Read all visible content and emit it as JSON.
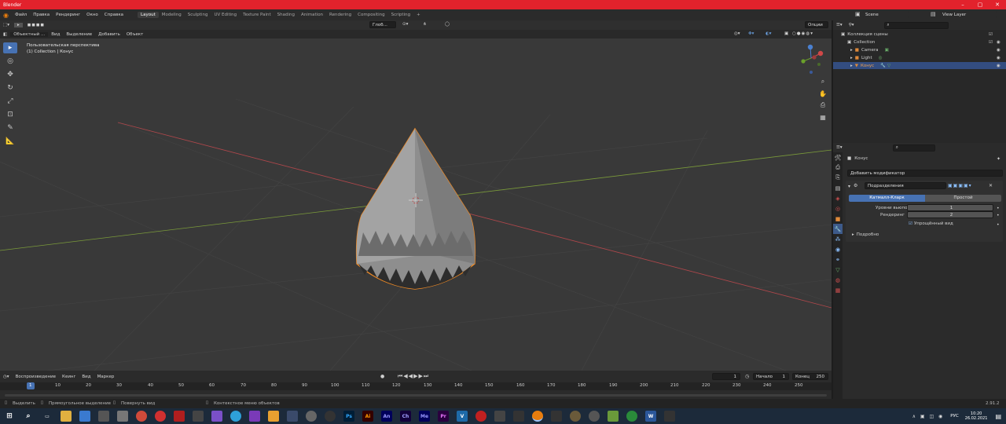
{
  "window": {
    "title": "Blender"
  },
  "menu": [
    "Файл",
    "Правка",
    "Рендеринг",
    "Окно",
    "Справка"
  ],
  "workspaces": [
    "Layout",
    "Modeling",
    "Sculpting",
    "UV Editing",
    "Texture Paint",
    "Shading",
    "Animation",
    "Rendering",
    "Compositing",
    "Scripting"
  ],
  "active_workspace": "Layout",
  "scene": {
    "name": "Scene",
    "view_layer": "View Layer"
  },
  "viewport": {
    "mode": "Объектный ...",
    "menu": [
      "Вид",
      "Выделение",
      "Добавить",
      "Объект"
    ],
    "transform_orientation": "Глоб...",
    "options": "Опции",
    "overlay_line1": "Пользовательская перспектива",
    "overlay_line2": "(1) Collection | Конус"
  },
  "outliner": {
    "root": "Коллекция сцены",
    "collection": "Collection",
    "items": [
      {
        "name": "Camera",
        "selected": false,
        "color": "#e08a3a"
      },
      {
        "name": "Light",
        "selected": false,
        "color": "#e08a3a"
      },
      {
        "name": "Конус",
        "selected": true,
        "color": "#e08a3a"
      }
    ]
  },
  "properties": {
    "object_name": "Конус",
    "add_modifier": "Добавить модификатор",
    "modifier_name": "Подразделения",
    "subdiv_types": [
      "Катмалл-Кларк",
      "Простой"
    ],
    "levels_viewport_label": "Уровни вьюпорта",
    "levels_viewport_value": "1",
    "render_label": "Рендеринг",
    "render_value": "2",
    "optimal_display": "Упрощённый вид",
    "advanced": "Подробно"
  },
  "timeline": {
    "menu": [
      "Воспроизведение",
      "Кеинг",
      "Вид",
      "Маркер"
    ],
    "current_frame": "1",
    "start_label": "Начало",
    "start_value": "1",
    "end_label": "Конец",
    "end_value": "250",
    "ruler": [
      "1",
      "10",
      "20",
      "30",
      "40",
      "50",
      "60",
      "70",
      "80",
      "90",
      "100",
      "110",
      "120",
      "130",
      "140",
      "150",
      "160",
      "170",
      "180",
      "190",
      "200",
      "210",
      "220",
      "230",
      "240",
      "250"
    ]
  },
  "status": {
    "select": "Выделить",
    "box_select": "Прямоугольное выделение",
    "rotate_view": "Повернуть вид",
    "context_menu": "Контекстное меню объектов",
    "version": "2.91.2"
  },
  "taskbar": {
    "lang": "РУС",
    "time": "10:20",
    "date": "26.02.2021",
    "apps": [
      {
        "label": "Ps",
        "color": "#001e36"
      },
      {
        "label": "Ai",
        "color": "#330000"
      },
      {
        "label": "An",
        "color": "#00005b"
      },
      {
        "label": "Ch",
        "color": "#13003b"
      },
      {
        "label": "Me",
        "color": "#00005b"
      },
      {
        "label": "Pr",
        "color": "#2a003f"
      }
    ]
  }
}
